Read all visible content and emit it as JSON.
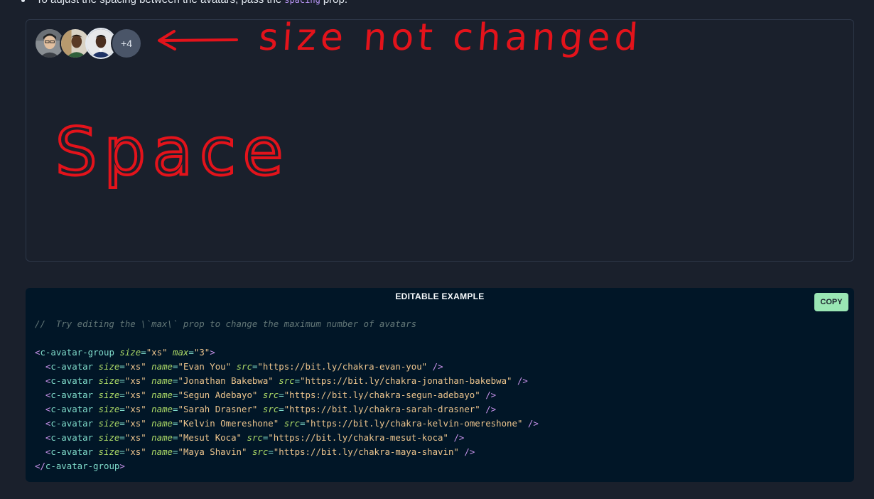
{
  "intro": {
    "before": "To adjust the spacing between the avatars, pass the",
    "code": "spacing",
    "after": "prop."
  },
  "avatar_group": {
    "more_label": "+4"
  },
  "annotations": {
    "arrow_note": "size not changed",
    "space_note": "Space",
    "color": "#e3131b"
  },
  "code_panel": {
    "header": "EDITABLE EXAMPLE",
    "copy_label": "COPY",
    "comment": "//  Try editing the \\`max\\` prop to change the maximum number of avatars",
    "group_tag": "c-avatar-group",
    "group_size": "\"xs\"",
    "group_max": "\"3\"",
    "item_tag": "c-avatar",
    "items": [
      {
        "size": "\"xs\"",
        "name": "\"Evan You\"",
        "src": "\"https://bit.ly/chakra-evan-you\""
      },
      {
        "size": "\"xs\"",
        "name": "\"Jonathan Bakebwa\"",
        "src": "\"https://bit.ly/chakra-jonathan-bakebwa\""
      },
      {
        "size": "\"xs\"",
        "name": "\"Segun Adebayo\"",
        "src": "\"https://bit.ly/chakra-segun-adebayo\""
      },
      {
        "size": "\"xs\"",
        "name": "\"Sarah Drasner\"",
        "src": "\"https://bit.ly/chakra-sarah-drasner\""
      },
      {
        "size": "\"xs\"",
        "name": "\"Kelvin Omereshone\"",
        "src": "\"https://bit.ly/chakra-kelvin-omereshone\""
      },
      {
        "size": "\"xs\"",
        "name": "\"Mesut Koca\"",
        "src": "\"https://bit.ly/chakra-mesut-koca\""
      },
      {
        "size": "\"xs\"",
        "name": "\"Maya Shavin\"",
        "src": "\"https://bit.ly/chakra-maya-shavin\""
      }
    ]
  }
}
